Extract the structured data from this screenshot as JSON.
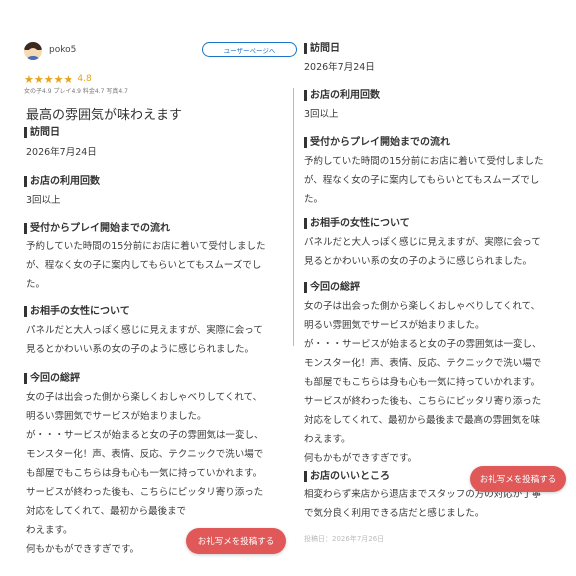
{
  "reviewer": {
    "username": "poko5",
    "user_page_label": "ユーザーページへ"
  },
  "rating": {
    "score": "4.8",
    "stars_value": 4.8,
    "subratings": "女の子4.9 プレイ4.9 料金4.7 写真4.7"
  },
  "review_title": "最高の雰囲気が味わえます",
  "left": {
    "visit_date_head": "訪問日",
    "visit_date": "2026年7月24日",
    "usage_head": "お店の利用回数",
    "usage": "3回以上",
    "flow_head": "受付からプレイ開始までの流れ",
    "flow_lines": [
      "予約していた時間の15分前にお店に着いて受付しました",
      "が、程なく女の子に案内してもらいとてもスムーズでし",
      "た。"
    ],
    "partner_head": "お相手の女性について",
    "partner_lines": [
      "パネルだと大人っぽく感じに見えますが、実際に会って",
      "見るとかわいい系の女の子のように感じられました。"
    ],
    "summary_head": "今回の総評",
    "summary_lines": [
      "女の子は出会った側から楽しくおしゃべりしてくれて、",
      "明るい雰囲気でサービスが始まりました。",
      "が・・・サービスが始まると女の子の雰囲気は一変し、",
      "モンスター化！声、表情、反応、テクニックで洗い場で",
      "も部屋でもこちらは身も心も一気に持っていかれます。",
      "サービスが終わった後も、こちらにピッタリ寄り添った",
      "対応をしてくれて、最初から最後まで",
      "わえます。",
      "何もかもができすぎです。"
    ]
  },
  "right": {
    "visit_date_head": "訪問日",
    "visit_date": "2026年7月24日",
    "usage_head": "お店の利用回数",
    "usage": "3回以上",
    "flow_head": "受付からプレイ開始までの流れ",
    "flow_lines": [
      "予約していた時間の15分前にお店に着いて受付しました",
      "が、程なく女の子に案内してもらいとてもスムーズでし",
      "た。"
    ],
    "partner_head": "お相手の女性について",
    "partner_lines": [
      "パネルだと大人っぽく感じに見えますが、実際に会って",
      "見るとかわいい系の女の子のように感じられました。"
    ],
    "summary_head": "今回の総評",
    "summary_lines": [
      "女の子は出会った側から楽しくおしゃべりしてくれて、",
      "明るい雰囲気でサービスが始まりました。",
      "が・・・サービスが始まると女の子の雰囲気は一変し、",
      "モンスター化！声、表情、反応、テクニックで洗い場で",
      "も部屋でもこちらは身も心も一気に持っていかれます。",
      "サービスが終わった後も、こちらにピッタリ寄り添った",
      "対応をしてくれて、最初から最後まで最高の雰囲気を味",
      "わえます。",
      "何もかもができすぎです。"
    ],
    "good_head": "お店のいいところ",
    "good_lines": [
      "相変わらず来店から退店までスタッフの方の対応が丁寧",
      "で気分良く利用できる店だと感じました。"
    ],
    "posted_date": "投稿日：2026年7月26日"
  },
  "cta_label": "お礼写メを投稿する",
  "colors": {
    "accent_blue": "#1a73c8",
    "star_gold": "#e7a41a",
    "cta_red": "#e05858"
  }
}
